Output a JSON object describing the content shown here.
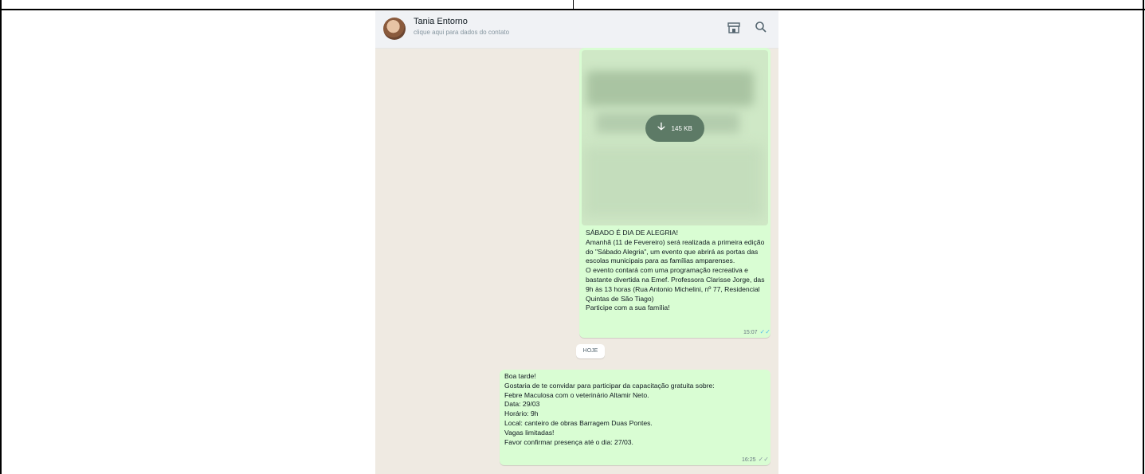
{
  "contact": {
    "name": "Tania Entorno",
    "subtitle": "clique aqui para dados do contato"
  },
  "header_icons": [
    "store-icon",
    "search-icon"
  ],
  "messages": [
    {
      "type": "image",
      "download_size": "145 KB",
      "text": "SÁBADO É DIA DE ALEGRIA!\nAmanhã (11 de Fevereiro) será realizada a primeira edição do \"Sábado Alegria\", um evento que abrirá as portas das escolas municipais para as famílias amparenses.\nO evento contará com uma programação recreativa e bastante divertida na Emef. Professora Clarisse Jorge, das 9h às 13 horas (Rua Antonio Michelini, nº 77, Residencial Quintas de São Tiago)\nParticipe com a sua família!",
      "time": "15:07"
    },
    {
      "type": "text",
      "text": "Boa tarde!\nGostaria de te convidar para participar da capacitação gratuita sobre:\nFebre Maculosa com o veterinário Altamir Neto.\nData: 29/03\nHorário: 9h\nLocal: canteiro de obras Barragem Duas Pontes.\nVagas limitadas!\nFavor confirmar presença até o dia: 27/03.",
      "time": "16:25"
    }
  ],
  "day_divider": "HOJE",
  "colors": {
    "chat_bg": "#efeae2",
    "outgoing_bubble": "#d9fdd3",
    "header_bg": "#f0f2f5",
    "read_ticks": "#53bdeb"
  }
}
